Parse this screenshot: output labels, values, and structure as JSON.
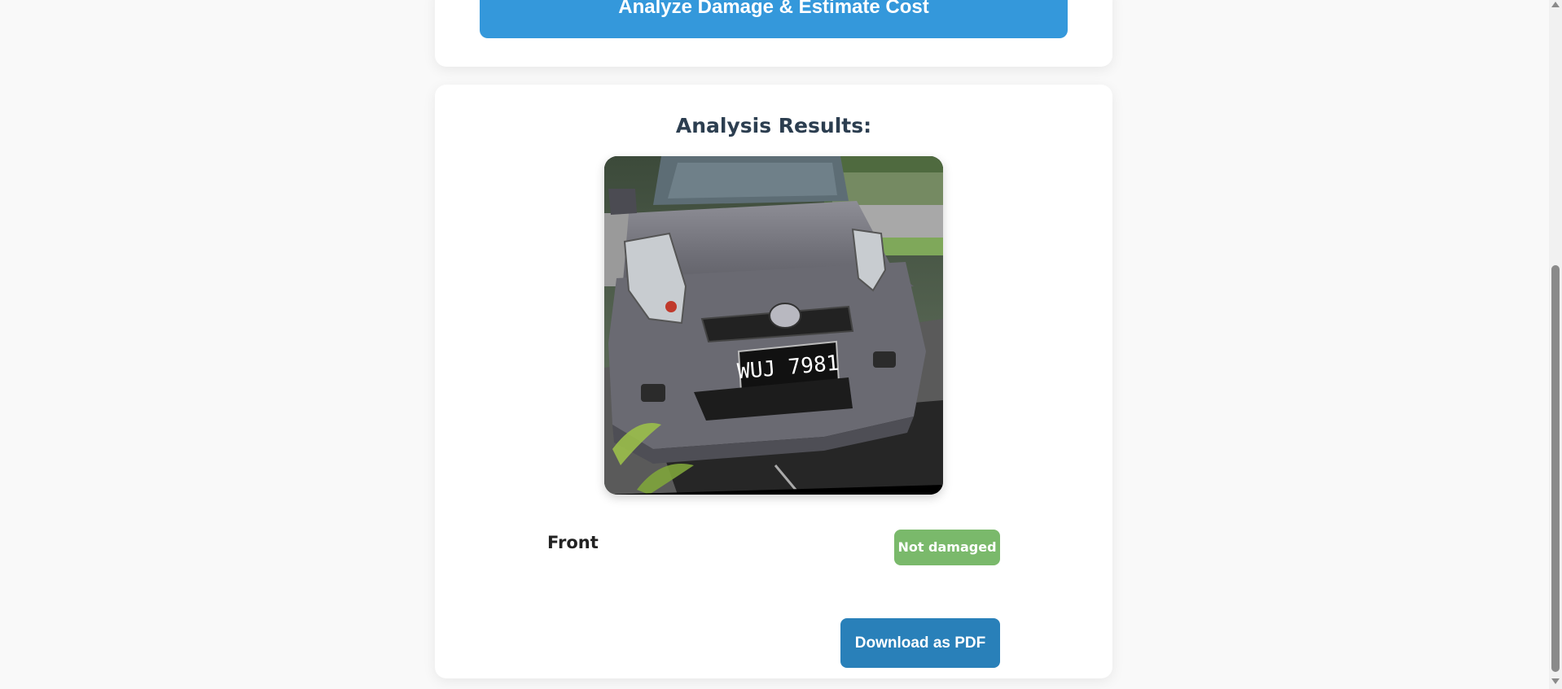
{
  "analyze_section": {
    "button_label": "Analyze Damage & Estimate Cost"
  },
  "results": {
    "title": "Analysis Results:",
    "image": {
      "plate_text": "WUJ 7981"
    },
    "items": [
      {
        "part": "Front",
        "status": "Not damaged",
        "status_color": "#7ab96b"
      }
    ],
    "download_label": "Download as PDF"
  },
  "colors": {
    "primary_button": "#3498db",
    "secondary_button": "#2980b9",
    "title_text": "#2c3e50",
    "page_background": "#f9f9f9"
  }
}
